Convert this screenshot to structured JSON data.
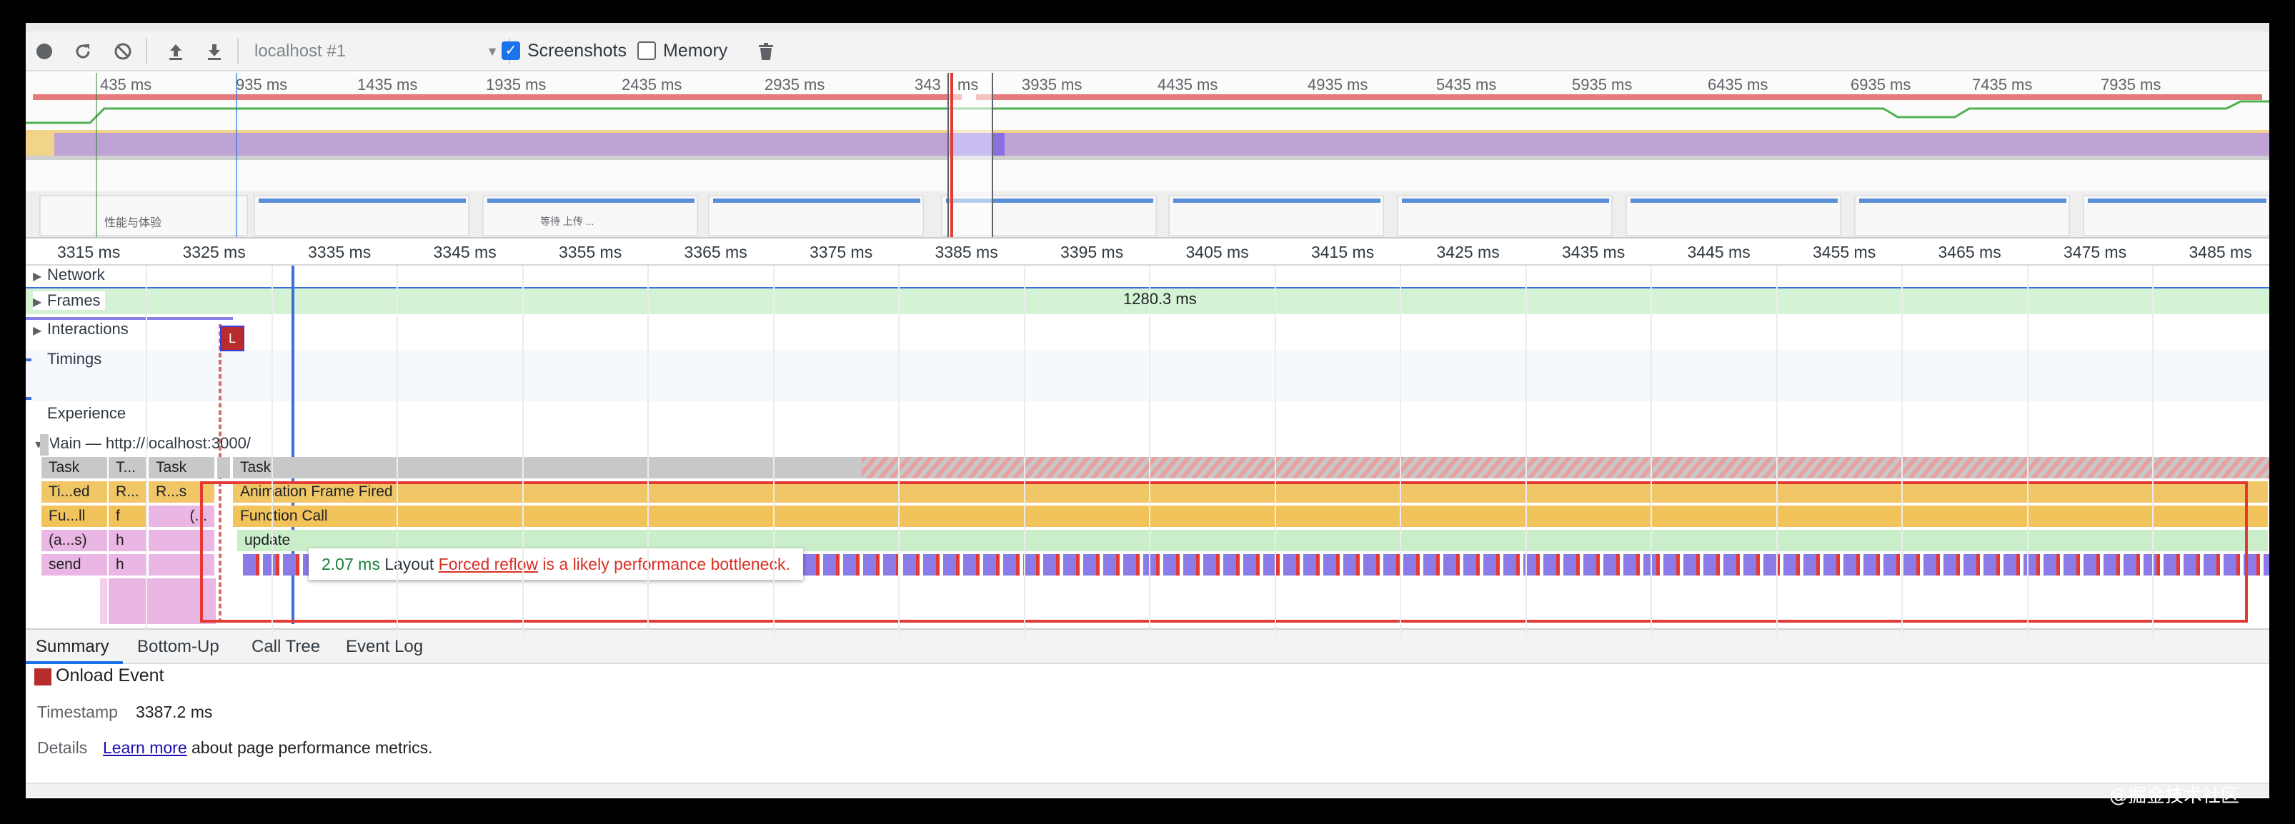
{
  "toolbar": {
    "target": "localhost #1",
    "screenshots_label": "Screenshots",
    "screenshots_checked": true,
    "memory_label": "Memory",
    "memory_checked": false
  },
  "overview": {
    "ticks": [
      "435 ms",
      "935 ms",
      "1435 ms",
      "1935 ms",
      "2435 ms",
      "2935 ms",
      "343",
      "ms",
      "3935 ms",
      "4435 ms",
      "4935 ms",
      "5435 ms",
      "5935 ms",
      "6435 ms",
      "6935 ms",
      "7435 ms",
      "7935 ms"
    ],
    "screenshot_captions": [
      "性能与体验",
      "等待 上传 ..."
    ]
  },
  "ruler": {
    "ticks": [
      "3315 ms",
      "3325 ms",
      "3335 ms",
      "3345 ms",
      "3355 ms",
      "3365 ms",
      "3375 ms",
      "3385 ms",
      "3395 ms",
      "3405 ms",
      "3415 ms",
      "3425 ms",
      "3435 ms",
      "3445 ms",
      "3455 ms",
      "3465 ms",
      "3475 ms",
      "3485 ms"
    ]
  },
  "tracks": {
    "network": "Network",
    "frames": "Frames",
    "frames_duration": "1280.3 ms",
    "interactions": "Interactions",
    "timings": "Timings",
    "timings_marker": "L",
    "experience": "Experience",
    "main": "Main — http://localhost:3000/"
  },
  "flame": {
    "row1": [
      "Task",
      "T...",
      "Task",
      "Task"
    ],
    "row2": [
      "Ti...ed",
      "R...",
      "R...s",
      "Animation Frame Fired"
    ],
    "row3": [
      "Fu...ll",
      "f",
      "(...",
      "Function Call"
    ],
    "row4": [
      "(a...s)",
      "h",
      "update"
    ],
    "row5": [
      "send",
      "h"
    ]
  },
  "tooltip": {
    "duration": "2.07 ms",
    "name": "Layout",
    "link": "Forced reflow",
    "warning": "is a likely performance bottleneck."
  },
  "bottom_tabs": [
    "Summary",
    "Bottom-Up",
    "Call Tree",
    "Event Log"
  ],
  "summary": {
    "title": "Onload Event",
    "timestamp_label": "Timestamp",
    "timestamp_value": "3387.2 ms",
    "details_label": "Details",
    "learn_more": "Learn more",
    "details_suffix": "about page performance metrics."
  },
  "watermark": "@掘金技术社区",
  "colors": {
    "accent": "#1a73e8",
    "highlight": "#e53935",
    "onload": "#b82c2c"
  }
}
